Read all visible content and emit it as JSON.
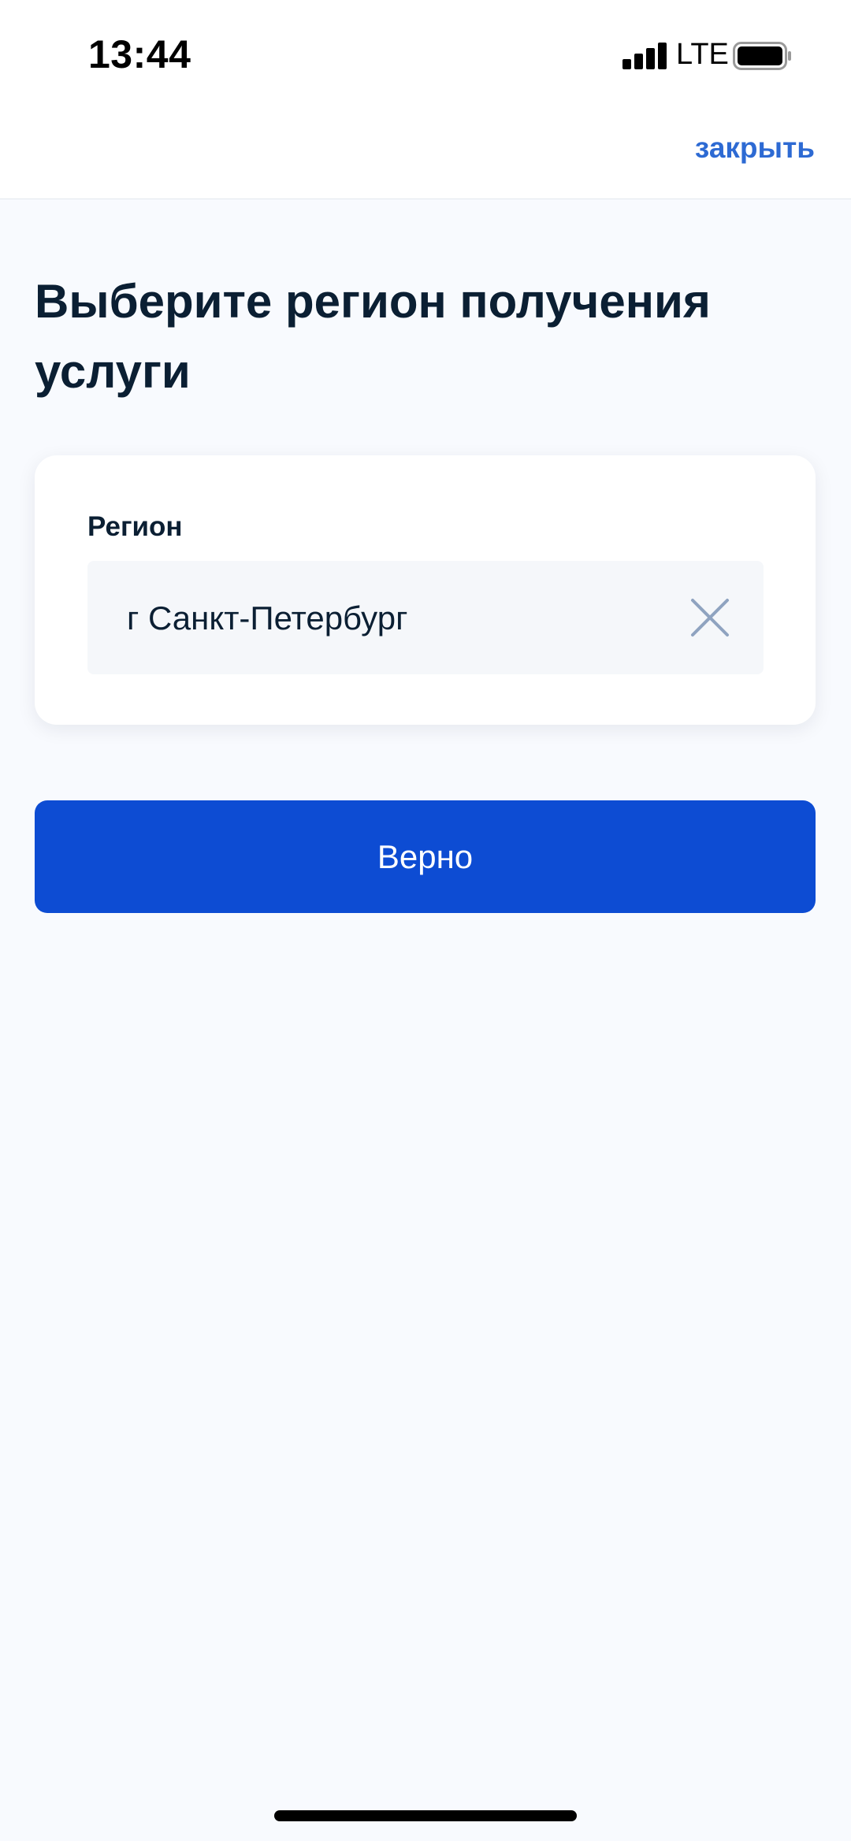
{
  "status_bar": {
    "time": "13:44",
    "network": "LTE",
    "icons": [
      "signal-bars-icon",
      "battery-icon"
    ]
  },
  "nav": {
    "close_label": "закрыть"
  },
  "page": {
    "title": "Выберите регион получения услуги"
  },
  "region_field": {
    "label": "Регион",
    "value": "г Санкт-Петербург",
    "clear_icon": "close-x-icon"
  },
  "actions": {
    "confirm_label": "Верно"
  },
  "colors": {
    "background": "#f8fafe",
    "primary": "#0d4cd3",
    "link": "#2d6ad3",
    "text": "#0b1f33",
    "input_bg": "#f5f7fa",
    "icon_muted": "#8fa3c0"
  }
}
